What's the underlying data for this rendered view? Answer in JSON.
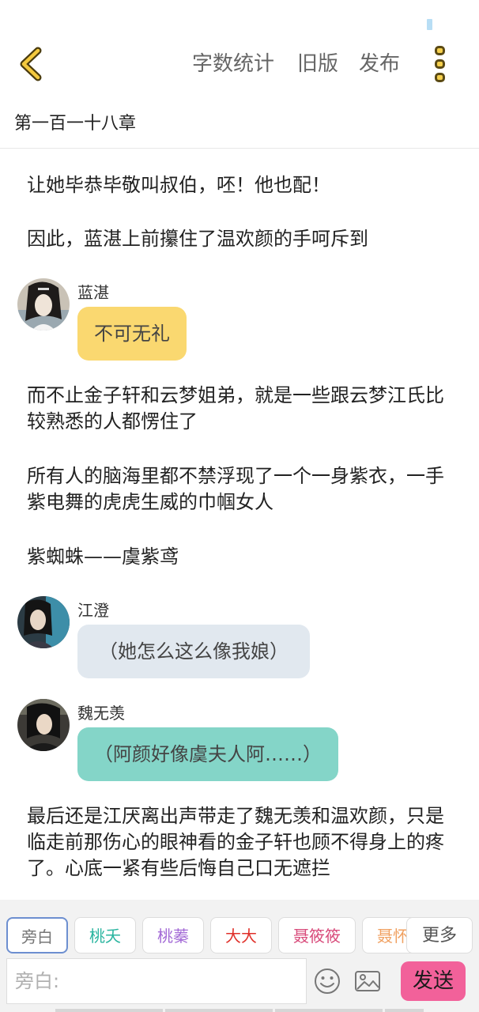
{
  "header": {
    "back_icon": "chevron-left-icon",
    "word_count": "字数统计",
    "old_version": "旧版",
    "publish": "发布",
    "more_icon": "vertical-dots-icon"
  },
  "chapter": {
    "title": "第一百一十八章"
  },
  "story": {
    "p1": "让她毕恭毕敬叫叔伯，呸！他也配！",
    "p2": "因此，蓝湛上前攥住了温欢颜的手呵斥到",
    "msg1": {
      "speaker": "蓝湛",
      "text": "不可无礼",
      "color": "#fad870"
    },
    "p3": "而不止金子轩和云梦姐弟，就是一些跟云梦江氏比较熟悉的人都愣住了",
    "p4": "所有人的脑海里都不禁浮现了一个一身紫衣，一手紫电舞的虎虎生威的巾帼女人",
    "p5": "紫蜘蛛——虞紫鸢",
    "msg2": {
      "speaker": "江澄",
      "text": "（她怎么这么像我娘）",
      "color": "#e1e8ef"
    },
    "msg3": {
      "speaker": "魏无羡",
      "text": "（阿颜好像虞夫人阿……）",
      "color": "#84d5c8"
    },
    "p6": "最后还是江厌离出声带走了魏无羡和温欢颜，只是临走前那伤心的眼神看的金子轩也顾不得身上的疼了。心底一紧有些后悔自己口无遮拦"
  },
  "roles": [
    {
      "label": "旁白",
      "color": "#777777"
    },
    {
      "label": "桃夭",
      "color": "#2bb5a0"
    },
    {
      "label": "桃蓁",
      "color": "#a36ad6"
    },
    {
      "label": "大大",
      "color": "#e0302a"
    },
    {
      "label": "聂筱筱",
      "color": "#d84a7a"
    },
    {
      "label": "聂怀",
      "color": "#f0a060"
    }
  ],
  "more_roles": "更多",
  "input": {
    "placeholder": "旁白:"
  },
  "toolbar": {
    "emoji_icon": "smiley-icon",
    "image_icon": "image-icon",
    "send_label": "发送"
  }
}
